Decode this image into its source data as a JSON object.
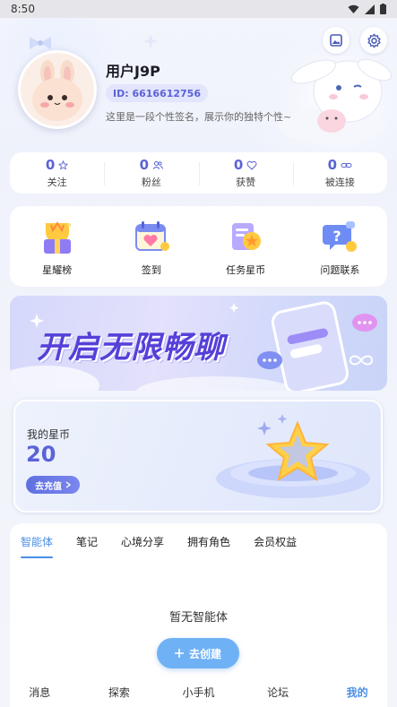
{
  "statusbar": {
    "time": "8:50"
  },
  "profile": {
    "username": "用户J9P",
    "id_label": "ID: 6616612756",
    "signature": "这里是一段个性签名，展示你的独特个性~"
  },
  "stats": [
    {
      "value": "0",
      "label": "关注",
      "icon": "star-icon"
    },
    {
      "value": "0",
      "label": "粉丝",
      "icon": "users-icon"
    },
    {
      "value": "0",
      "label": "获赞",
      "icon": "heart-icon"
    },
    {
      "value": "0",
      "label": "被连接",
      "icon": "link-icon"
    }
  ],
  "features": [
    {
      "label": "星耀榜",
      "icon": "trophy-gift-icon"
    },
    {
      "label": "签到",
      "icon": "calendar-checkin-icon"
    },
    {
      "label": "任务星币",
      "icon": "task-coin-icon"
    },
    {
      "label": "问题联系",
      "icon": "question-chat-icon"
    }
  ],
  "banner": {
    "text": "开启无限畅聊"
  },
  "coins": {
    "title": "我的星币",
    "value": "20",
    "button": "去充值"
  },
  "tabs": [
    "智能体",
    "笔记",
    "心境分享",
    "拥有角色",
    "会员权益"
  ],
  "empty": {
    "text": "暂无智能体",
    "create_button": "去创建"
  },
  "nav": [
    "消息",
    "探索",
    "小手机",
    "论坛",
    "我的"
  ],
  "colors": {
    "accent": "#5a63d6",
    "tab_active": "#4a8fe8",
    "create_button": "#6fb1f5"
  }
}
